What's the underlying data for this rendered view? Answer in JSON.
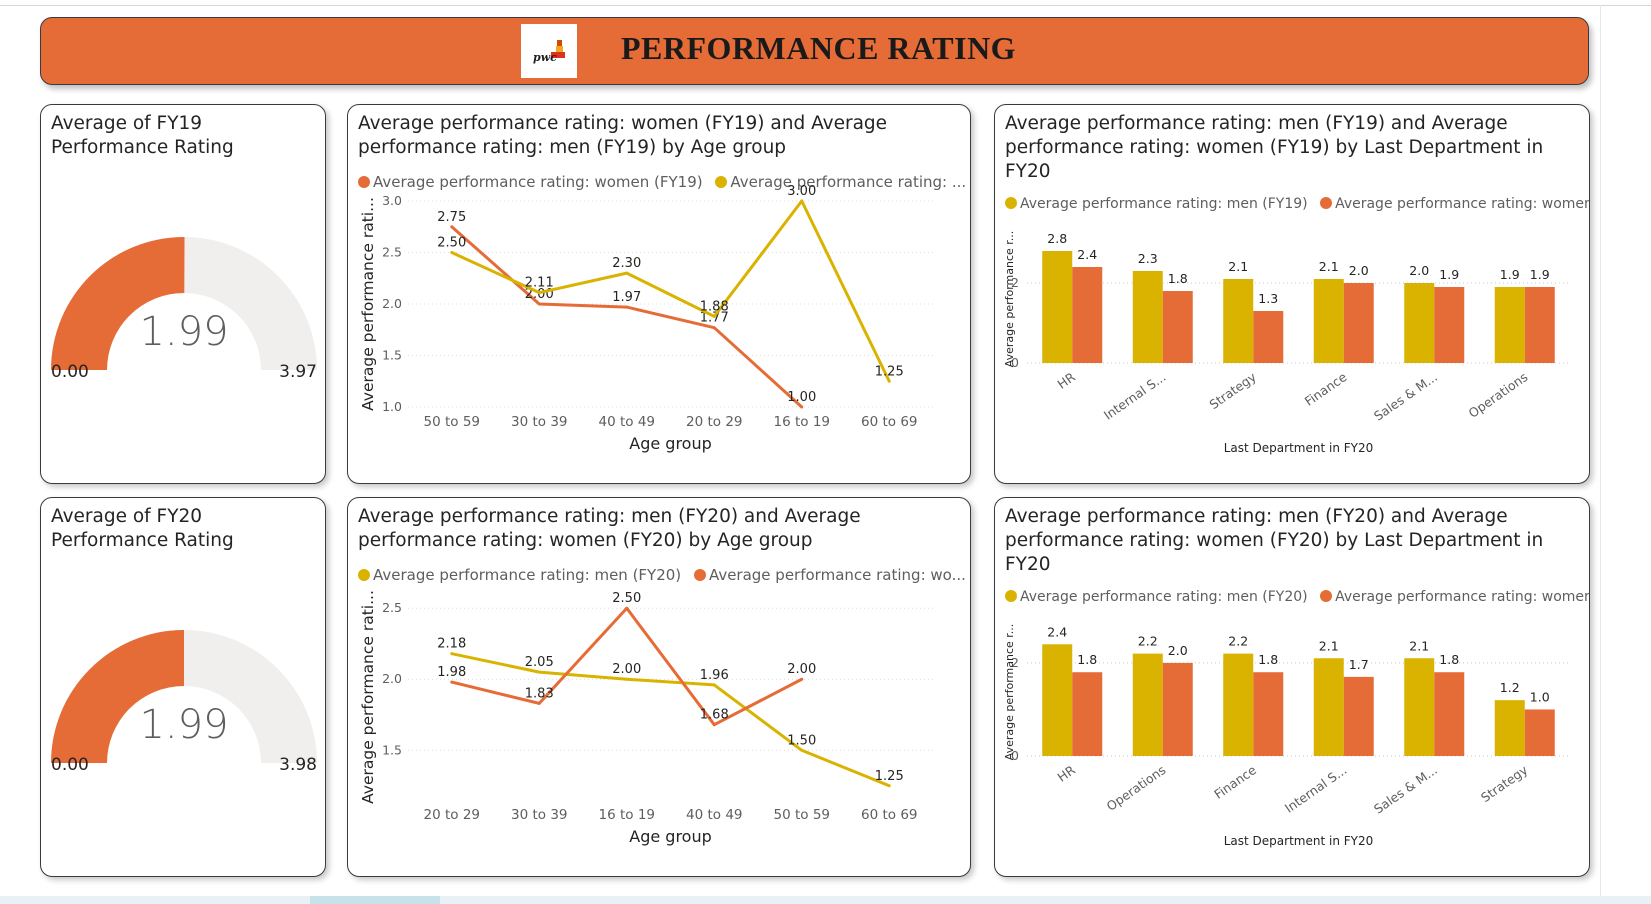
{
  "header": {
    "title": "PERFORMANCE RATING",
    "logo_text": "pwc"
  },
  "colors": {
    "orange": "#e66c37",
    "gold": "#d9b300",
    "track": "#f0efee"
  },
  "gauges": [
    {
      "title": "Average of FY19 Performance Rating",
      "value": 1.99,
      "display": "1.99",
      "min": "0.00",
      "max": "3.97",
      "max_value": 3.97
    },
    {
      "title": "Average of FY20 Performance Rating",
      "value": 1.99,
      "display": "1.99",
      "min": "0.00",
      "max": "3.98",
      "max_value": 3.98
    }
  ],
  "chart_data": [
    {
      "type": "line",
      "title": "Average performance rating: women (FY19) and Average performance rating: men (FY19) by Age group",
      "legend": [
        "Average performance rating: women (FY19)",
        "Average performance rating: ..."
      ],
      "xlabel": "Age group",
      "ylabel": "Average performance rati...",
      "categories": [
        "50 to 59",
        "30 to 39",
        "40 to 49",
        "20 to 29",
        "16 to 19",
        "60 to 69"
      ],
      "ylim": [
        1.0,
        3.0
      ],
      "yticks": [
        1.0,
        1.5,
        2.0,
        2.5,
        3.0
      ],
      "ytick_labels": [
        "1.0",
        "1.5",
        "2.0",
        "2.5",
        "3.0"
      ],
      "series": [
        {
          "name": "Average performance rating: women (FY19)",
          "color": "#e66c37",
          "values": [
            2.75,
            2.0,
            1.97,
            1.77,
            1.0,
            null
          ],
          "labels": [
            "2.75",
            "2.00",
            "1.97",
            "1.77",
            "1.00",
            ""
          ]
        },
        {
          "name": "Average performance rating: men (FY19)",
          "color": "#d9b300",
          "values": [
            2.5,
            2.11,
            2.3,
            1.88,
            3.0,
            1.25
          ],
          "labels": [
            "2.50",
            "2.11",
            "2.30",
            "1.88",
            "3.00",
            "1.25"
          ]
        }
      ]
    },
    {
      "type": "bar",
      "title": "Average performance rating: men (FY19) and Average performance rating: women (FY19) by Last Department in FY20",
      "legend": [
        "Average performance rating: men (FY19)",
        "Average performance rating: women (..."
      ],
      "xlabel": "Last Department in FY20",
      "ylabel": "Average performance r...",
      "categories": [
        "HR",
        "Internal S...",
        "Strategy",
        "Finance",
        "Sales & M...",
        "Operations"
      ],
      "ylim": [
        0,
        3.2
      ],
      "yticks": [
        0,
        2
      ],
      "ytick_labels": [
        "0",
        "2"
      ],
      "series": [
        {
          "name": "Average performance rating: men (FY19)",
          "color": "#d9b300",
          "values": [
            2.8,
            2.3,
            2.1,
            2.1,
            2.0,
            1.9
          ],
          "labels": [
            "2.8",
            "2.3",
            "2.1",
            "2.1",
            "2.0",
            "1.9"
          ]
        },
        {
          "name": "Average performance rating: women (FY19)",
          "color": "#e66c37",
          "values": [
            2.4,
            1.8,
            1.3,
            2.0,
            1.9,
            1.9
          ],
          "labels": [
            "2.4",
            "1.8",
            "1.3",
            "2.0",
            "1.9",
            "1.9"
          ]
        }
      ]
    },
    {
      "type": "line",
      "title": "Average performance rating: men (FY20) and Average performance rating: women (FY20) by Age group",
      "legend": [
        "Average performance rating: men (FY20)",
        "Average performance rating: wo..."
      ],
      "xlabel": "Age group",
      "ylabel": "Average performance rati...",
      "categories": [
        "20 to 29",
        "30 to 39",
        "16 to 19",
        "40 to 49",
        "50 to 59",
        "60 to 69"
      ],
      "ylim": [
        1.15,
        2.6
      ],
      "yticks": [
        1.5,
        2.0,
        2.5
      ],
      "ytick_labels": [
        "1.5",
        "2.0",
        "2.5"
      ],
      "series": [
        {
          "name": "Average performance rating: men (FY20)",
          "color": "#d9b300",
          "values": [
            2.18,
            2.05,
            2.0,
            1.96,
            1.5,
            1.25
          ],
          "labels": [
            "2.18",
            "2.05",
            "2.00",
            "1.96",
            "1.50",
            "1.25"
          ]
        },
        {
          "name": "Average performance rating: women (FY20)",
          "color": "#e66c37",
          "values": [
            1.98,
            1.83,
            2.5,
            1.68,
            2.0,
            null
          ],
          "labels": [
            "1.98",
            "1.83",
            "2.50",
            "1.68",
            "2.00",
            ""
          ]
        }
      ]
    },
    {
      "type": "bar",
      "title": "Average performance rating: men (FY20) and Average performance rating: women (FY20) by Last Department in FY20",
      "legend": [
        "Average performance rating: men (FY20)",
        "Average performance rating: women (..."
      ],
      "xlabel": "Last Department in FY20",
      "ylabel": "Average performance r...",
      "categories": [
        "HR",
        "Operations",
        "Finance",
        "Internal S...",
        "Sales & M...",
        "Strategy"
      ],
      "ylim": [
        0,
        2.75
      ],
      "yticks": [
        0,
        2
      ],
      "ytick_labels": [
        "0",
        "2"
      ],
      "series": [
        {
          "name": "Average performance rating: men (FY20)",
          "color": "#d9b300",
          "values": [
            2.4,
            2.2,
            2.2,
            2.1,
            2.1,
            1.2
          ],
          "labels": [
            "2.4",
            "2.2",
            "2.2",
            "2.1",
            "2.1",
            "1.2"
          ]
        },
        {
          "name": "Average performance rating: women (FY20)",
          "color": "#e66c37",
          "values": [
            1.8,
            2.0,
            1.8,
            1.7,
            1.8,
            1.0
          ],
          "labels": [
            "1.8",
            "2.0",
            "1.8",
            "1.7",
            "1.8",
            "1.0"
          ]
        }
      ]
    }
  ]
}
